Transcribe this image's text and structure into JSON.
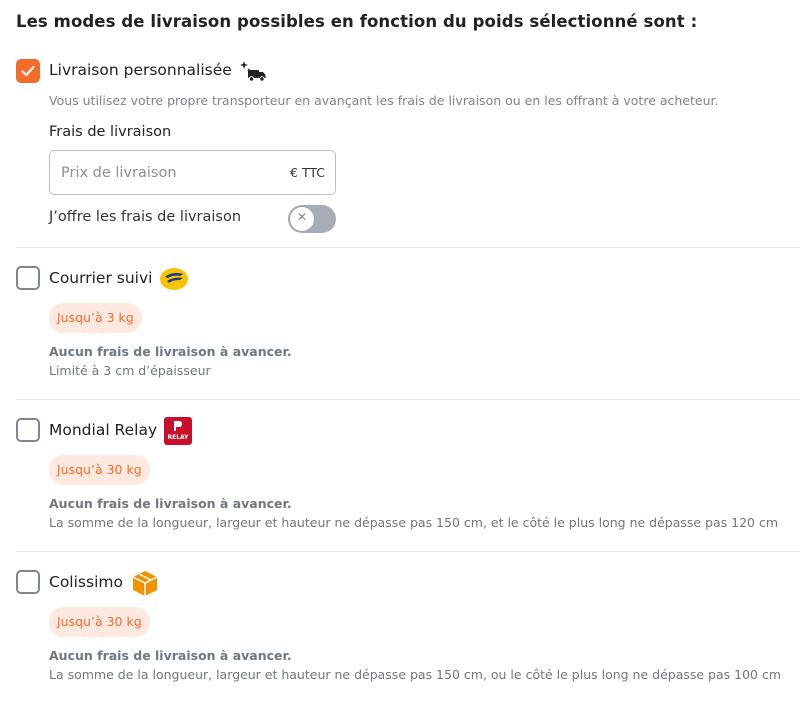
{
  "title": "Les modes de livraison possibles en fonction du poids sélectionné sont :",
  "custom": {
    "label": "Livraison personnalisée",
    "checked": true,
    "icon": "sparkle-truck-icon",
    "description": "Vous utilisez votre propre transporteur en avançant les frais de livraison ou en les offrant à votre acheteur.",
    "fee_label": "Frais de livraison",
    "fee_placeholder": "Prix de livraison",
    "fee_value": "",
    "fee_unit": "€ TTC",
    "free_shipping_label": "J’offre les frais de livraison",
    "free_shipping_on": false
  },
  "options": [
    {
      "label": "Courrier suivi",
      "checked": false,
      "icon": "la-poste-icon",
      "badge": "Jusqu’à 3 kg",
      "info_strong": "Aucun frais de livraison à avancer.",
      "info": "Limité à 3 cm d’épaisseur"
    },
    {
      "label": "Mondial Relay",
      "checked": false,
      "icon": "mondial-relay-icon",
      "icon_text": "RELAY",
      "badge": "Jusqu’à 30 kg",
      "info_strong": "Aucun frais de livraison à avancer.",
      "info": "La somme de la longueur, largeur et hauteur ne dépasse pas 150 cm, et le côté le plus long ne dépasse pas 120 cm"
    },
    {
      "label": "Colissimo",
      "checked": false,
      "icon": "colissimo-box-icon",
      "badge": "Jusqu’à 30 kg",
      "info_strong": "Aucun frais de livraison à avancer.",
      "info": "La somme de la longueur, largeur et hauteur ne dépasse pas 150 cm, ou le côté le plus long ne dépasse pas 100 cm"
    }
  ],
  "colors": {
    "accent": "#f56b2a",
    "badge_bg": "#fde9df",
    "toggle_off": "#a6adb7",
    "muted_text": "#7b8590"
  }
}
